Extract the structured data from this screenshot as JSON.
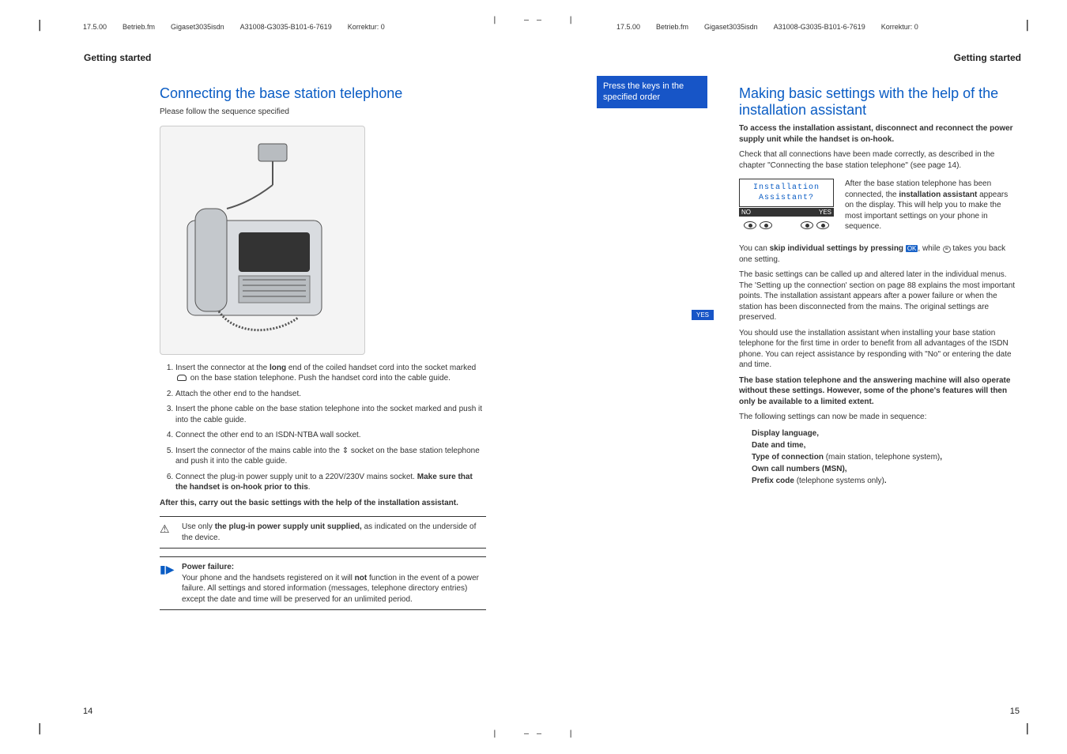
{
  "running_head": {
    "date": "17.5.00",
    "file": "Betrieb.fm",
    "product": "Gigaset3035isdn",
    "partno": "A31008-G3035-B101-6-7619",
    "korrektur": "Korrektur: 0"
  },
  "left": {
    "section": "Getting started",
    "h2": "Connecting the base station telephone",
    "intro": "Please follow the sequence specified",
    "steps": [
      "Insert the connector at the long end of the coiled handset cord into the socket marked ✆ on the base station telephone. Push the handset cord into the cable guide.",
      "Attach the other end to the handset.",
      "Insert the phone cable on the base station telephone into the socket marked  and push it into the cable guide.",
      "Connect the other end to an ISDN-NTBA wall socket.",
      "Insert the connector of the mains cable into the  ↑  socket on the base station telephone and push it into the cable guide.",
      "Connect the plug-in power supply unit to a 220V/230V mains socket. Make sure that the handset is on-hook prior to this."
    ],
    "step1_bold": "long",
    "step6_bold": "Make sure that the handset is on-hook prior to this",
    "after": "After this, carry out the basic settings with the help of the installation assistant.",
    "warn_pre": "Use only ",
    "warn_bold": "the plug-in power supply unit supplied,",
    "warn_post": " as indicated on the underside of the device.",
    "note_title": "Power failure:",
    "note_body_pre": "Your phone and the handsets registered on it will ",
    "note_body_bold": "not",
    "note_body_post": " function in the event of a power failure. All settings and stored information (messages, telephone directory entries) except the date and time will be preserved for an unlimited period.",
    "page_num": "14"
  },
  "right": {
    "section": "Getting started",
    "side_label": "Press the keys in the specified order",
    "yes_tag": "YES",
    "h2": "Making basic settings with the help of the installation assistant",
    "access_bold": "To access the installation assistant, disconnect and reconnect the power supply unit while the handset is on-hook.",
    "check": "Check that all connections have been made correctly, as described in the chapter \"Connecting the base station telephone\" (see page 14).",
    "lcd_line1": "Installation",
    "lcd_line2": "Assistant?",
    "soft_no": "NO",
    "soft_yes": "YES",
    "display_text_pre": "After the base station telephone has been connected, the ",
    "display_text_bold": "installation assistant",
    "display_text_post": " appears on the display. This will help you to make the most important settings on your phone in sequence.",
    "skip_pre": "You can ",
    "skip_bold": "skip individual settings by pressing ",
    "skip_ok": "OK",
    "skip_post": ", while ",
    "skip_tail": " takes you back one setting.",
    "para2": "The basic settings can be called up and altered later in the individual menus. The 'Setting up the connection' section on page 88 explains the most important points. The installation assistant appears after a power failure or when the station has been disconnected from the mains. The original settings are preserved.",
    "para3": "You should use the installation assistant when installing your base station telephone for the first time in order to benefit from all advantages of the ISDN phone. You can reject assistance by responding with \"No\" or entering the date and time.",
    "warn2": "The base station telephone and the answering machine will also operate without these settings. However, some of the phone's features will then only be available to a limited extent.",
    "following": "The following settings can now be made in sequence:",
    "settings": {
      "s1": "Display language,",
      "s2": "Date and time,",
      "s3a": "Type of connection ",
      "s3b": "(main station, telephone system)",
      "s3c": ",",
      "s4": "Own call numbers (MSN),",
      "s5a": "Prefix code ",
      "s5b": "(telephone systems only)",
      "s5c": "."
    },
    "page_num": "15"
  }
}
